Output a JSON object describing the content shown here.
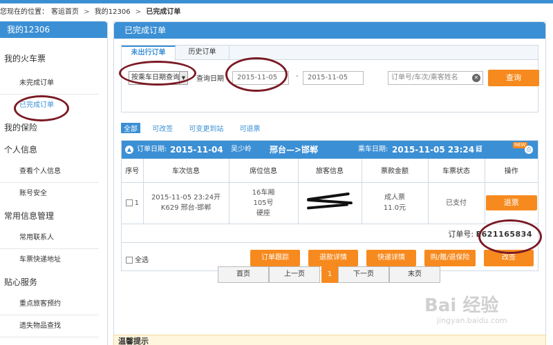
{
  "breadcrumb": {
    "prefix": "您现在的位置：",
    "items": [
      "客运首页",
      "我的12306"
    ],
    "current": "已完成订单",
    "separator": ">"
  },
  "sidebar": {
    "title": "我的12306",
    "sections": [
      {
        "label": "我的火车票",
        "items": [
          {
            "label": "未完成订单"
          },
          {
            "label": "已完成订单",
            "active": true
          }
        ]
      },
      {
        "label": "我的保险",
        "items": []
      },
      {
        "label": "个人信息",
        "items": [
          {
            "label": "查看个人信息"
          },
          {
            "label": "账号安全"
          }
        ]
      },
      {
        "label": "常用信息管理",
        "items": [
          {
            "label": "常用联系人"
          },
          {
            "label": "车票快递地址"
          }
        ]
      },
      {
        "label": "贴心服务",
        "items": [
          {
            "label": "重点旅客预约"
          },
          {
            "label": "遗失物品查找"
          }
        ]
      }
    ]
  },
  "main": {
    "title": "已完成订单",
    "tabs": [
      {
        "label": "未出行订单",
        "active": true
      },
      {
        "label": "历史订单"
      }
    ],
    "query": {
      "select_value": "按乘车日期查询",
      "date_label": "查询日期",
      "date_from": "2015-11-05",
      "date_to": "2015-11-05",
      "dash": "-",
      "search_placeholder": "订单号/车次/乘客姓名",
      "query_button": "查询"
    },
    "filters": [
      "全部",
      "可改签",
      "可变更到站",
      "可退票"
    ],
    "order": {
      "order_date_label": "订单日期:",
      "order_date": "2015-11-04",
      "passenger_name": "吴少岭",
      "route": "邢台—>邯郸",
      "ride_date_label": "乘车日期:",
      "ride_date": "2015-11-05 23:24",
      "detail_label": "订单详情",
      "new_badge": "NEW",
      "columns": [
        "序号",
        "车次信息",
        "席位信息",
        "旅客信息",
        "票款金额",
        "车票状态",
        "操作"
      ],
      "row": {
        "index": "1",
        "train_time": "2015-11-05 23:24开",
        "train_route": "K629 邢台-邯郸",
        "seat_car": "16车厢",
        "seat_no": "105号",
        "seat_type": "硬座",
        "ticket_type": "成人票",
        "price": "11.0元",
        "status": "已支付",
        "action": "退票"
      },
      "order_no_label": "订单号:",
      "order_no": "E621165834",
      "select_all": "全选",
      "buttons": [
        "订单跟踪",
        "退款详情",
        "快递详情",
        "购/赠/退保险",
        "改签"
      ]
    },
    "pager": {
      "first": "首页",
      "prev": "上一页",
      "current": "1",
      "next": "下一页",
      "last": "末页"
    }
  },
  "tips": {
    "title": "温馨提示"
  },
  "watermark": {
    "text": "Bai 经验",
    "sub": "jingyan.baidu.com"
  }
}
